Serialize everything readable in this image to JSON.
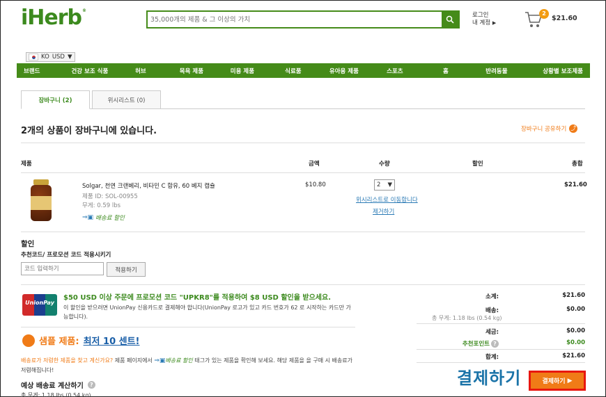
{
  "header": {
    "logo": "iHerb",
    "search_placeholder": "35,000개의 제품 & 그 이상의 가치",
    "login_label": "로그인",
    "account_label": "내 계정",
    "cart_count": "2",
    "cart_total": "$21.60"
  },
  "locale": {
    "lang": "KO",
    "currency": "USD"
  },
  "nav": [
    "브랜드",
    "건강 보조 식품",
    "허브",
    "목욕 제품",
    "미용 제품",
    "식료품",
    "유아용 제품",
    "스포츠",
    "홈",
    "반려동물",
    "상황별 보조제품"
  ],
  "tabs": {
    "cart": "장바구니 (2)",
    "wishlist": "위시리스트 (0)"
  },
  "heading": "2개의 상품이 장바구니에 있습니다.",
  "share_label": "장바구니 공유하기",
  "columns": {
    "product": "제품",
    "price": "금액",
    "qty": "수량",
    "discount": "할인",
    "total": "총합"
  },
  "item": {
    "name": "Solgar, 천연 크랜베리, 비타민 C 함유, 60 베지 캡슐",
    "id": "제품 ID: SOL-00955",
    "weight": "무게: 0.59 lbs",
    "ship_tag": "배송료 할인",
    "price": "$10.80",
    "qty": "2",
    "move_link": "위시리스트로 이동합니다",
    "remove_link": "제거하기",
    "total": "$21.60"
  },
  "discount": {
    "title": "할인",
    "subtitle": "추천코드/ 프로모션 코드 적용시키기",
    "input_placeholder": "코드 입력하기",
    "apply_label": "적용하기"
  },
  "promo": {
    "card_brand": "UnionPay",
    "title": "$50 USD 이상 주문에 프로모션 코드 \"UPKR8\"를 적용하여 $8 USD 할인을 받으세요.",
    "desc": "이 할인을 받으려면 UnionPay 신용카드로 결제해야 합니다(UnionPay 로고가 있고 카드 번호가 62 로 시작하는 카드만 가능합니다)."
  },
  "sample": {
    "title": "샘플 제품:",
    "link": "최저 10 센트!"
  },
  "low_ship": {
    "prefix": "배송료가 저렴한 제품을 찾고 계신가요?",
    "mid": " 제품 페이지에서 ",
    "tag": "배송료 할인",
    "suffix": " 태그가 있는 제품을 확인해 보세요. 해당 제품을 을 구매 시 배송료가 저렴해집니다!"
  },
  "estimate": {
    "title": "예상 배송료 계산하기",
    "weight": "총 무게: 1.18 lbs (0.54 kg)"
  },
  "summary": {
    "subtotal_label": "소계:",
    "subtotal": "$21.60",
    "shipping_label": "배송:",
    "shipping": "$0.00",
    "weight": "총 무게: 1.18 lbs (0.54 kg)",
    "tax_label": "세금:",
    "tax": "$0.00",
    "points_label": "추천포인트",
    "points": "$0.00",
    "total_label": "합계:",
    "total": "$21.60"
  },
  "checkout": {
    "overlay": "결제하기",
    "button": "결제하기"
  },
  "colors": {
    "brand_green": "#458b19",
    "accent_orange": "#f07b17",
    "link_blue": "#2a7ab5",
    "highlight_red": "#e8170f"
  }
}
